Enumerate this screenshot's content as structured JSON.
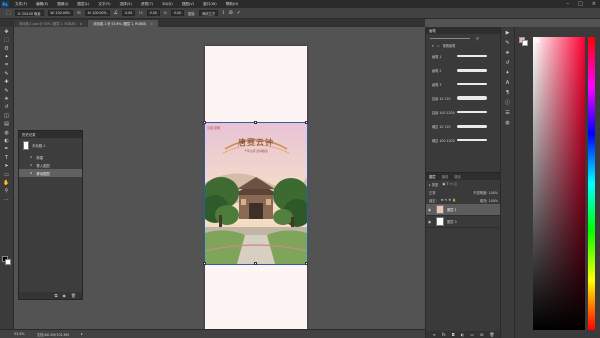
{
  "app": {
    "logo": "Ps",
    "menu": [
      "文件(F)",
      "编辑(E)",
      "图像(I)",
      "图层(L)",
      "文字(Y)",
      "选择(S)",
      "滤镜(T)",
      "3D(D)",
      "视图(V)",
      "窗口(W)",
      "帮助(H)"
    ],
    "window_controls": [
      "–",
      "□",
      "×"
    ]
  },
  "options": {
    "x": "X: 254.00 像素",
    "w": "W: 100.00%",
    "h": "H: 100.00%",
    "angle": "0.00",
    "h_skew": "0.00",
    "v_skew": "0.00",
    "interp_label": "插值:",
    "interp_value": "两次立方",
    "cancel_icon": "⊘",
    "commit_icon": "✓"
  },
  "tabs": [
    {
      "label": "未标题-1.psd @ 50% (图层 1, RGB/8)",
      "active": false
    },
    {
      "label": "未标题-1 @ 53.6% (图层 1, RGB/8)",
      "active": true
    }
  ],
  "tools": [
    "move-icon",
    "marquee-icon",
    "lasso-icon",
    "magic-wand-icon",
    "crop-icon",
    "eyedropper-icon",
    "healing-icon",
    "brush-icon",
    "stamp-icon",
    "history-brush-icon",
    "eraser-icon",
    "gradient-icon",
    "blur-icon",
    "dodge-icon",
    "pen-icon",
    "type-icon",
    "path-select-icon",
    "shape-icon",
    "hand-icon",
    "zoom-icon",
    "extra-icon"
  ],
  "tool_glyphs": [
    "✥",
    "⬚",
    "ʘ",
    "✦",
    "⌗",
    "✎",
    "✚",
    "✎",
    "⎈",
    "↺",
    "◫",
    "▤",
    "◍",
    "◐",
    "✒",
    "T",
    "➤",
    "▭",
    "✋",
    "⚲",
    "⋯"
  ],
  "history": {
    "title": "历史记录",
    "snapshot": "未标题-1",
    "items": [
      {
        "label": "新建",
        "selected": false
      },
      {
        "label": "置入图层",
        "selected": false
      },
      {
        "label": "移动图层",
        "selected": true
      }
    ]
  },
  "artwork": {
    "stamp_line1": "云南·昆明",
    "title": "唐赛云钟",
    "subtitle": "千年古寺 晨钟暮鼓"
  },
  "brushes": {
    "title": "画笔",
    "group_label": "常规画笔",
    "items": [
      {
        "label": "画笔 1",
        "size": 10
      },
      {
        "label": "画笔 2",
        "size": 12
      },
      {
        "label": "画笔 3",
        "size": 8
      },
      {
        "label": "边缘 10 120",
        "size": 14
      },
      {
        "label": "边缘 100 1200",
        "size": 10
      },
      {
        "label": "硬边 10 120",
        "size": 12
      },
      {
        "label": "硬边 100 1200",
        "size": 9
      }
    ]
  },
  "layers": {
    "tabs": [
      "图层",
      "通道",
      "路径"
    ],
    "blend": "正常",
    "opacity": "不透明度: 100%",
    "fill": "填充: 100%",
    "lock": "锁定:",
    "rows": [
      {
        "name": "图层 1",
        "selected": true
      },
      {
        "name": "图层 0",
        "selected": false
      }
    ]
  },
  "status": {
    "zoom": "53.6%",
    "doc": "文档:80.2M/102.6M"
  },
  "colors": {
    "foreground": "#f2b2b2",
    "background": "#ffffff",
    "accent": "#31a8ff",
    "hue": "#ff0033"
  }
}
